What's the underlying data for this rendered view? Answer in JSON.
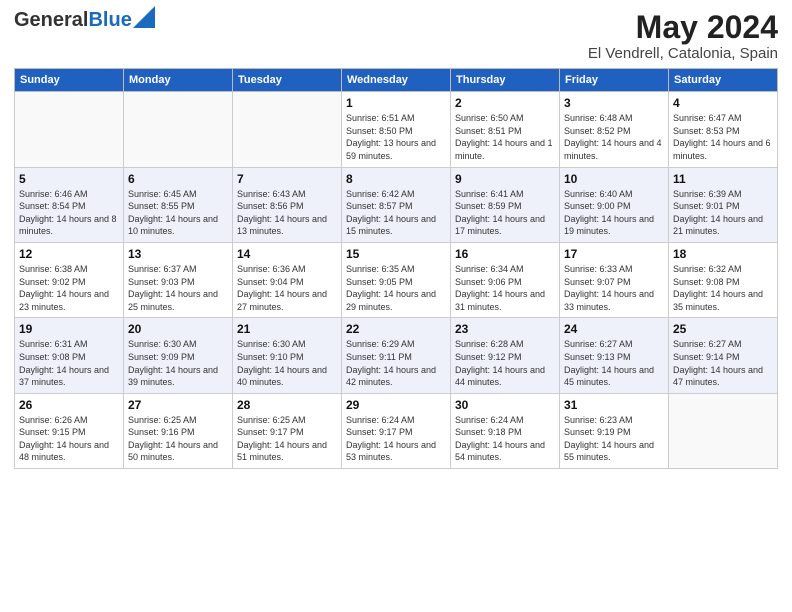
{
  "header": {
    "logo_general": "General",
    "logo_blue": "Blue",
    "month": "May 2024",
    "location": "El Vendrell, Catalonia, Spain"
  },
  "weekdays": [
    "Sunday",
    "Monday",
    "Tuesday",
    "Wednesday",
    "Thursday",
    "Friday",
    "Saturday"
  ],
  "weeks": [
    [
      {
        "date": "",
        "sunrise": "",
        "sunset": "",
        "daylight": ""
      },
      {
        "date": "",
        "sunrise": "",
        "sunset": "",
        "daylight": ""
      },
      {
        "date": "",
        "sunrise": "",
        "sunset": "",
        "daylight": ""
      },
      {
        "date": "1",
        "sunrise": "Sunrise: 6:51 AM",
        "sunset": "Sunset: 8:50 PM",
        "daylight": "Daylight: 13 hours and 59 minutes."
      },
      {
        "date": "2",
        "sunrise": "Sunrise: 6:50 AM",
        "sunset": "Sunset: 8:51 PM",
        "daylight": "Daylight: 14 hours and 1 minute."
      },
      {
        "date": "3",
        "sunrise": "Sunrise: 6:48 AM",
        "sunset": "Sunset: 8:52 PM",
        "daylight": "Daylight: 14 hours and 4 minutes."
      },
      {
        "date": "4",
        "sunrise": "Sunrise: 6:47 AM",
        "sunset": "Sunset: 8:53 PM",
        "daylight": "Daylight: 14 hours and 6 minutes."
      }
    ],
    [
      {
        "date": "5",
        "sunrise": "Sunrise: 6:46 AM",
        "sunset": "Sunset: 8:54 PM",
        "daylight": "Daylight: 14 hours and 8 minutes."
      },
      {
        "date": "6",
        "sunrise": "Sunrise: 6:45 AM",
        "sunset": "Sunset: 8:55 PM",
        "daylight": "Daylight: 14 hours and 10 minutes."
      },
      {
        "date": "7",
        "sunrise": "Sunrise: 6:43 AM",
        "sunset": "Sunset: 8:56 PM",
        "daylight": "Daylight: 14 hours and 13 minutes."
      },
      {
        "date": "8",
        "sunrise": "Sunrise: 6:42 AM",
        "sunset": "Sunset: 8:57 PM",
        "daylight": "Daylight: 14 hours and 15 minutes."
      },
      {
        "date": "9",
        "sunrise": "Sunrise: 6:41 AM",
        "sunset": "Sunset: 8:59 PM",
        "daylight": "Daylight: 14 hours and 17 minutes."
      },
      {
        "date": "10",
        "sunrise": "Sunrise: 6:40 AM",
        "sunset": "Sunset: 9:00 PM",
        "daylight": "Daylight: 14 hours and 19 minutes."
      },
      {
        "date": "11",
        "sunrise": "Sunrise: 6:39 AM",
        "sunset": "Sunset: 9:01 PM",
        "daylight": "Daylight: 14 hours and 21 minutes."
      }
    ],
    [
      {
        "date": "12",
        "sunrise": "Sunrise: 6:38 AM",
        "sunset": "Sunset: 9:02 PM",
        "daylight": "Daylight: 14 hours and 23 minutes."
      },
      {
        "date": "13",
        "sunrise": "Sunrise: 6:37 AM",
        "sunset": "Sunset: 9:03 PM",
        "daylight": "Daylight: 14 hours and 25 minutes."
      },
      {
        "date": "14",
        "sunrise": "Sunrise: 6:36 AM",
        "sunset": "Sunset: 9:04 PM",
        "daylight": "Daylight: 14 hours and 27 minutes."
      },
      {
        "date": "15",
        "sunrise": "Sunrise: 6:35 AM",
        "sunset": "Sunset: 9:05 PM",
        "daylight": "Daylight: 14 hours and 29 minutes."
      },
      {
        "date": "16",
        "sunrise": "Sunrise: 6:34 AM",
        "sunset": "Sunset: 9:06 PM",
        "daylight": "Daylight: 14 hours and 31 minutes."
      },
      {
        "date": "17",
        "sunrise": "Sunrise: 6:33 AM",
        "sunset": "Sunset: 9:07 PM",
        "daylight": "Daylight: 14 hours and 33 minutes."
      },
      {
        "date": "18",
        "sunrise": "Sunrise: 6:32 AM",
        "sunset": "Sunset: 9:08 PM",
        "daylight": "Daylight: 14 hours and 35 minutes."
      }
    ],
    [
      {
        "date": "19",
        "sunrise": "Sunrise: 6:31 AM",
        "sunset": "Sunset: 9:08 PM",
        "daylight": "Daylight: 14 hours and 37 minutes."
      },
      {
        "date": "20",
        "sunrise": "Sunrise: 6:30 AM",
        "sunset": "Sunset: 9:09 PM",
        "daylight": "Daylight: 14 hours and 39 minutes."
      },
      {
        "date": "21",
        "sunrise": "Sunrise: 6:30 AM",
        "sunset": "Sunset: 9:10 PM",
        "daylight": "Daylight: 14 hours and 40 minutes."
      },
      {
        "date": "22",
        "sunrise": "Sunrise: 6:29 AM",
        "sunset": "Sunset: 9:11 PM",
        "daylight": "Daylight: 14 hours and 42 minutes."
      },
      {
        "date": "23",
        "sunrise": "Sunrise: 6:28 AM",
        "sunset": "Sunset: 9:12 PM",
        "daylight": "Daylight: 14 hours and 44 minutes."
      },
      {
        "date": "24",
        "sunrise": "Sunrise: 6:27 AM",
        "sunset": "Sunset: 9:13 PM",
        "daylight": "Daylight: 14 hours and 45 minutes."
      },
      {
        "date": "25",
        "sunrise": "Sunrise: 6:27 AM",
        "sunset": "Sunset: 9:14 PM",
        "daylight": "Daylight: 14 hours and 47 minutes."
      }
    ],
    [
      {
        "date": "26",
        "sunrise": "Sunrise: 6:26 AM",
        "sunset": "Sunset: 9:15 PM",
        "daylight": "Daylight: 14 hours and 48 minutes."
      },
      {
        "date": "27",
        "sunrise": "Sunrise: 6:25 AM",
        "sunset": "Sunset: 9:16 PM",
        "daylight": "Daylight: 14 hours and 50 minutes."
      },
      {
        "date": "28",
        "sunrise": "Sunrise: 6:25 AM",
        "sunset": "Sunset: 9:17 PM",
        "daylight": "Daylight: 14 hours and 51 minutes."
      },
      {
        "date": "29",
        "sunrise": "Sunrise: 6:24 AM",
        "sunset": "Sunset: 9:17 PM",
        "daylight": "Daylight: 14 hours and 53 minutes."
      },
      {
        "date": "30",
        "sunrise": "Sunrise: 6:24 AM",
        "sunset": "Sunset: 9:18 PM",
        "daylight": "Daylight: 14 hours and 54 minutes."
      },
      {
        "date": "31",
        "sunrise": "Sunrise: 6:23 AM",
        "sunset": "Sunset: 9:19 PM",
        "daylight": "Daylight: 14 hours and 55 minutes."
      },
      {
        "date": "",
        "sunrise": "",
        "sunset": "",
        "daylight": ""
      }
    ]
  ]
}
